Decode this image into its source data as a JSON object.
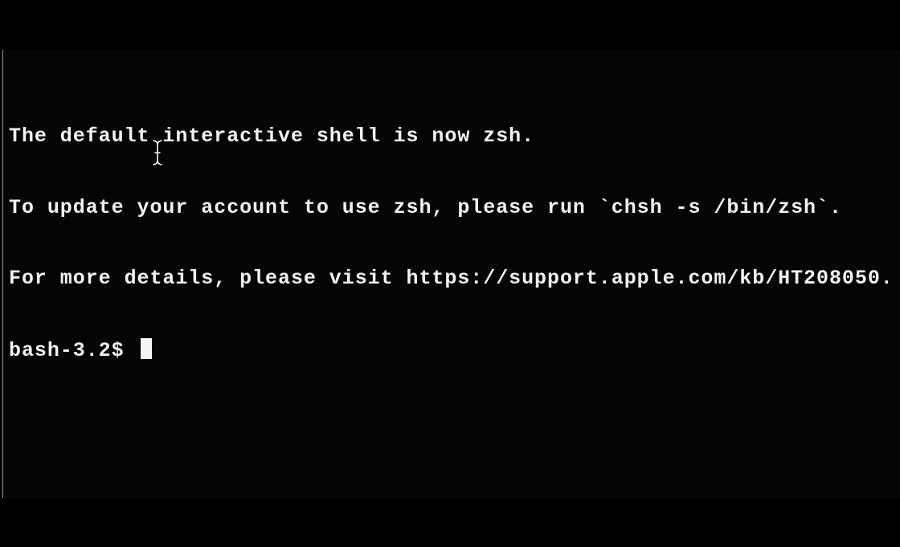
{
  "terminal": {
    "lines": [
      "The default interactive shell is now zsh.",
      "To update your account to use zsh, please run `chsh -s /bin/zsh`.",
      "For more details, please visit https://support.apple.com/kb/HT208050."
    ],
    "prompt": "bash-3.2$ ",
    "input_value": "",
    "colors": {
      "background": "#050505",
      "text": "#f2f2f2",
      "cursor": "#f5f5f5"
    }
  },
  "icons": {
    "cursor": "text-cursor-icon",
    "pointer": "i-beam-mouse-icon"
  }
}
